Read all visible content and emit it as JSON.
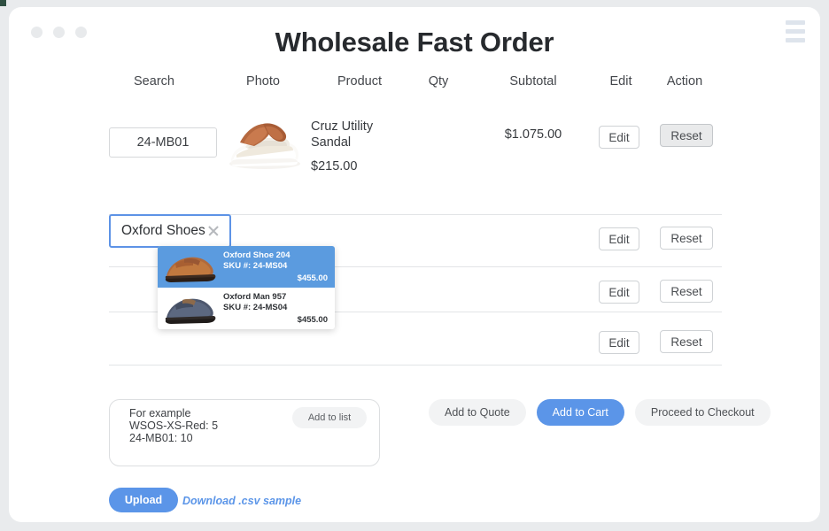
{
  "window": {
    "dots": [
      "dot-1",
      "dot-2",
      "dot-3"
    ],
    "menu_icon": "hamburger-menu-icon"
  },
  "header": {
    "title": "Wholesale Fast Order"
  },
  "table": {
    "columns": [
      "Search",
      "Photo",
      "Product",
      "Qty",
      "Subtotal",
      "Edit",
      "Action"
    ],
    "rows": [
      {
        "sku": "24-MB01",
        "photo": "sandal-photo",
        "product_name": "Cruz Utility Sandal",
        "product_price": "$215.00",
        "qty": "",
        "subtotal": "$1.075.00",
        "edit_label": "Edit",
        "action_label": "Reset",
        "action_active": true
      },
      {
        "sku": "Oxford Shoes",
        "photo": "",
        "product_name": "",
        "product_price": "",
        "qty": "",
        "subtotal": "",
        "edit_label": "Edit",
        "action_label": "Reset",
        "action_active": false
      },
      {
        "sku": "",
        "photo": "",
        "product_name": "",
        "product_price": "",
        "qty": "",
        "subtotal": "",
        "edit_label": "Edit",
        "action_label": "Reset",
        "action_active": false
      },
      {
        "sku": "",
        "photo": "",
        "product_name": "",
        "product_price": "",
        "qty": "",
        "subtotal": "",
        "edit_label": "Edit",
        "action_label": "Reset",
        "action_active": false
      }
    ]
  },
  "search": {
    "value": "Oxford Shoes",
    "clear_icon": "clear-x-icon",
    "suggestions": [
      {
        "name": "Oxford Shoe 204",
        "sku": "SKU #: 24-MS04",
        "price": "$455.00",
        "thumb": "brown-oxford-shoe",
        "selected": true
      },
      {
        "name": "Oxford Man 957",
        "sku": "SKU #: 24-MS04",
        "price": "$455.00",
        "thumb": "blue-oxford-shoe",
        "selected": false
      }
    ]
  },
  "bulk": {
    "example_text": "For example\nWSOS-XS-Red: 5\n24-MB01: 10",
    "add_to_list_label": "Add to list"
  },
  "actions": {
    "add_to_quote": "Add to Quote",
    "add_to_cart": "Add to Cart",
    "proceed_to_checkout": "Proceed to Checkout"
  },
  "upload": {
    "button_label": "Upload",
    "csv_link_label": "Download .csv sample"
  },
  "colors": {
    "accent_blue": "#5b95e8",
    "dropdown_selected": "#5b9bdf",
    "page_bg": "#e9ebed",
    "card_bg": "#ffffff",
    "divider": "#e2e4e6",
    "text_primary": "#36393d",
    "hamburger": "#dee4ec"
  }
}
